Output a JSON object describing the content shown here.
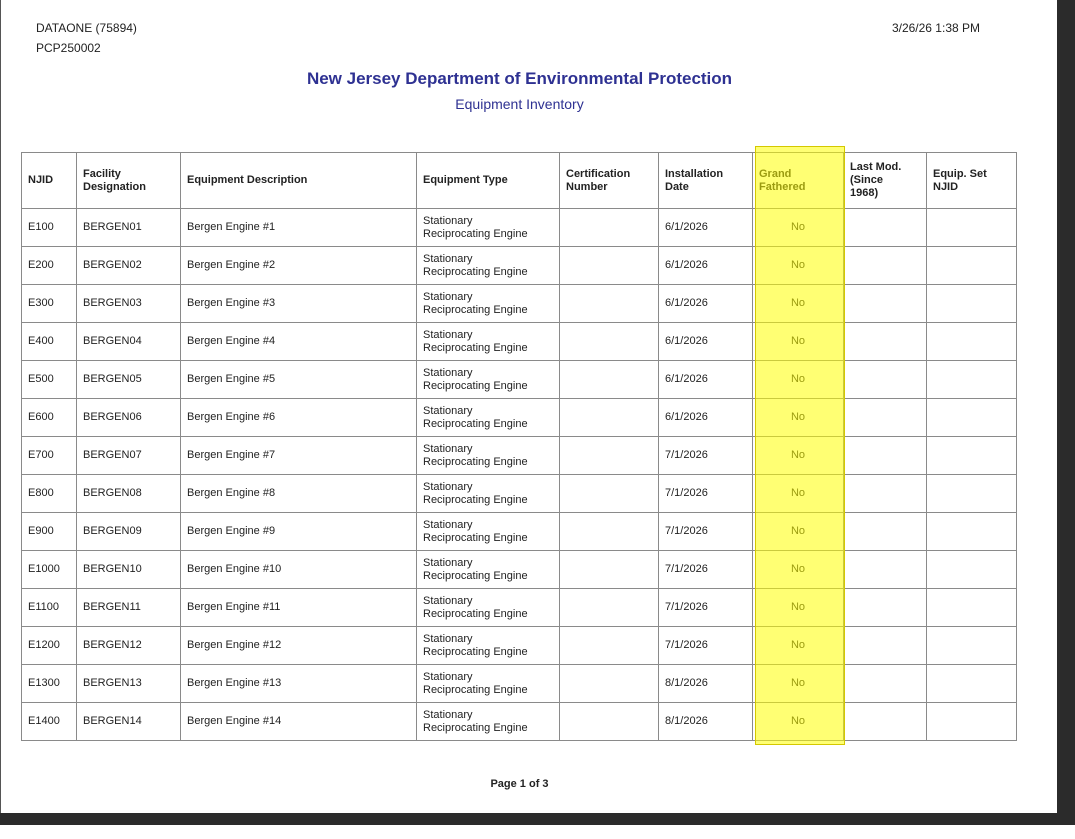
{
  "header": {
    "left_line1": "DATAONE (75894)",
    "left_line2": "PCP250002",
    "timestamp": "3/26/26 1:38 PM"
  },
  "title": "New Jersey Department of Environmental Protection",
  "subtitle": "Equipment Inventory",
  "highlight_color": "#ffff00",
  "columns": [
    {
      "line1": "NJID",
      "line2": "",
      "line3": ""
    },
    {
      "line1": "Facility",
      "line2": "Designation",
      "line3": ""
    },
    {
      "line1": "Equipment Description",
      "line2": "",
      "line3": ""
    },
    {
      "line1": "Equipment Type",
      "line2": "",
      "line3": ""
    },
    {
      "line1": "Certification",
      "line2": "Number",
      "line3": ""
    },
    {
      "line1": "Installation",
      "line2": "Date",
      "line3": ""
    },
    {
      "line1": "Grand",
      "line2": "Fathered",
      "line3": ""
    },
    {
      "line1": "Last Mod.",
      "line2": "(Since",
      "line3": "1968)"
    },
    {
      "line1": "Equip. Set",
      "line2": "NJID",
      "line3": ""
    }
  ],
  "rows": [
    {
      "njid": "E100",
      "facility": "BERGEN01",
      "desc": "Bergen Engine #1",
      "type1": "Stationary",
      "type2": "Reciprocating Engine",
      "cert": "",
      "date": "6/1/2026",
      "gf": "No",
      "lastmod": "",
      "setnjid": ""
    },
    {
      "njid": "E200",
      "facility": "BERGEN02",
      "desc": "Bergen Engine #2",
      "type1": "Stationary",
      "type2": "Reciprocating Engine",
      "cert": "",
      "date": "6/1/2026",
      "gf": "No",
      "lastmod": "",
      "setnjid": ""
    },
    {
      "njid": "E300",
      "facility": "BERGEN03",
      "desc": "Bergen Engine #3",
      "type1": "Stationary",
      "type2": "Reciprocating Engine",
      "cert": "",
      "date": "6/1/2026",
      "gf": "No",
      "lastmod": "",
      "setnjid": ""
    },
    {
      "njid": "E400",
      "facility": "BERGEN04",
      "desc": "Bergen Engine #4",
      "type1": "Stationary",
      "type2": "Reciprocating Engine",
      "cert": "",
      "date": "6/1/2026",
      "gf": "No",
      "lastmod": "",
      "setnjid": ""
    },
    {
      "njid": "E500",
      "facility": "BERGEN05",
      "desc": "Bergen Engine #5",
      "type1": "Stationary",
      "type2": "Reciprocating Engine",
      "cert": "",
      "date": "6/1/2026",
      "gf": "No",
      "lastmod": "",
      "setnjid": ""
    },
    {
      "njid": "E600",
      "facility": "BERGEN06",
      "desc": "Bergen Engine #6",
      "type1": "Stationary",
      "type2": "Reciprocating Engine",
      "cert": "",
      "date": "6/1/2026",
      "gf": "No",
      "lastmod": "",
      "setnjid": ""
    },
    {
      "njid": "E700",
      "facility": "BERGEN07",
      "desc": "Bergen Engine #7",
      "type1": "Stationary",
      "type2": "Reciprocating Engine",
      "cert": "",
      "date": "7/1/2026",
      "gf": "No",
      "lastmod": "",
      "setnjid": ""
    },
    {
      "njid": "E800",
      "facility": "BERGEN08",
      "desc": "Bergen Engine #8",
      "type1": "Stationary",
      "type2": "Reciprocating Engine",
      "cert": "",
      "date": "7/1/2026",
      "gf": "No",
      "lastmod": "",
      "setnjid": ""
    },
    {
      "njid": "E900",
      "facility": "BERGEN09",
      "desc": "Bergen Engine #9",
      "type1": "Stationary",
      "type2": "Reciprocating Engine",
      "cert": "",
      "date": "7/1/2026",
      "gf": "No",
      "lastmod": "",
      "setnjid": ""
    },
    {
      "njid": "E1000",
      "facility": "BERGEN10",
      "desc": "Bergen Engine #10",
      "type1": "Stationary",
      "type2": "Reciprocating Engine",
      "cert": "",
      "date": "7/1/2026",
      "gf": "No",
      "lastmod": "",
      "setnjid": ""
    },
    {
      "njid": "E1100",
      "facility": "BERGEN11",
      "desc": "Bergen Engine #11",
      "type1": "Stationary",
      "type2": "Reciprocating Engine",
      "cert": "",
      "date": "7/1/2026",
      "gf": "No",
      "lastmod": "",
      "setnjid": ""
    },
    {
      "njid": "E1200",
      "facility": "BERGEN12",
      "desc": "Bergen Engine #12",
      "type1": "Stationary",
      "type2": "Reciprocating Engine",
      "cert": "",
      "date": "7/1/2026",
      "gf": "No",
      "lastmod": "",
      "setnjid": ""
    },
    {
      "njid": "E1300",
      "facility": "BERGEN13",
      "desc": "Bergen Engine #13",
      "type1": "Stationary",
      "type2": "Reciprocating Engine",
      "cert": "",
      "date": "8/1/2026",
      "gf": "No",
      "lastmod": "",
      "setnjid": ""
    },
    {
      "njid": "E1400",
      "facility": "BERGEN14",
      "desc": "Bergen Engine #14",
      "type1": "Stationary",
      "type2": "Reciprocating Engine",
      "cert": "",
      "date": "8/1/2026",
      "gf": "No",
      "lastmod": "",
      "setnjid": ""
    }
  ],
  "footer": "Page 1 of 3"
}
